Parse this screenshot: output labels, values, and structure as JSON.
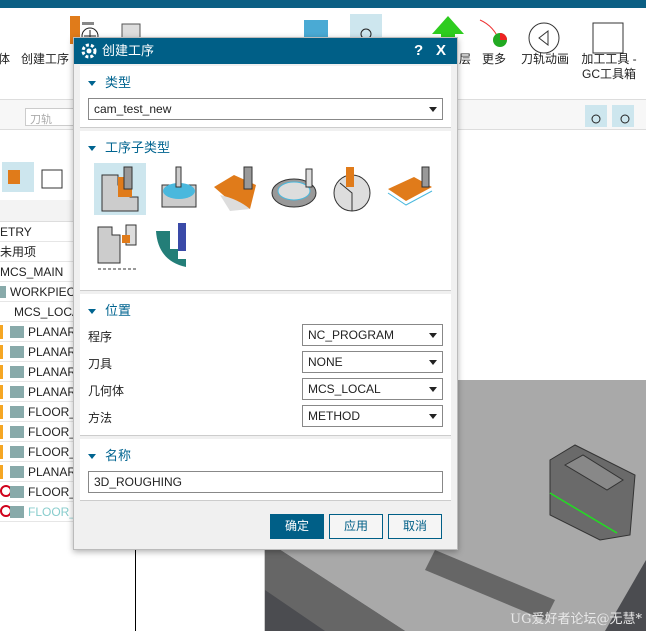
{
  "ribbon": {
    "items": [
      {
        "label": "体",
        "icon": "geometry-icon"
      },
      {
        "label": "创建工序",
        "icon": "create-operation-icon"
      },
      {
        "label": "层",
        "icon": "layer-icon"
      },
      {
        "label": "更多",
        "icon": "more-icon"
      },
      {
        "label": "刀轨动画",
        "icon": "toolpath-animation-icon"
      },
      {
        "label": "加工工具 -\nGC工具箱",
        "icon": "gc-toolbox-icon"
      }
    ],
    "filter_placeholder": "刀轨"
  },
  "navigator": {
    "rows": [
      {
        "label": "ETRY"
      },
      {
        "label": "未用项"
      },
      {
        "label": "MCS_MAIN"
      },
      {
        "label": "WORKPIECE"
      },
      {
        "label": "MCS_LOCAL"
      },
      {
        "label": "PLANAR",
        "status": "warning"
      },
      {
        "label": "PLANAR",
        "status": "warning"
      },
      {
        "label": "PLANAR",
        "status": "warning"
      },
      {
        "label": "PLANAR",
        "status": "warning"
      },
      {
        "label": "FLOOR_",
        "status": "warning"
      },
      {
        "label": "FLOOR_",
        "status": "warning"
      },
      {
        "label": "FLOOR_",
        "status": "warning"
      },
      {
        "label": "PLANAR",
        "status": "warning"
      },
      {
        "label": "FLOOR_",
        "status": "error"
      },
      {
        "label": "FLOOR_",
        "status": "error",
        "dimmed": true
      }
    ]
  },
  "dialog": {
    "title": "创建工序",
    "help": "?",
    "close": "X",
    "type_section": {
      "title": "类型",
      "value": "cam_test_new"
    },
    "subtype_section": {
      "title": "工序子类型",
      "subtypes": [
        "cavity-mill",
        "adaptive-milling",
        "zlevel-profile",
        "plunge-milling",
        "corner-rough",
        "rest-milling",
        "turning-rough",
        "zlevel-corner"
      ],
      "selected": 0
    },
    "location_section": {
      "title": "位置",
      "fields": [
        {
          "label": "程序",
          "value": "NC_PROGRAM"
        },
        {
          "label": "刀具",
          "value": "NONE"
        },
        {
          "label": "几何体",
          "value": "MCS_LOCAL"
        },
        {
          "label": "方法",
          "value": "METHOD"
        }
      ]
    },
    "name_section": {
      "title": "名称",
      "value": "3D_ROUGHING"
    },
    "buttons": {
      "ok": "确定",
      "apply": "应用",
      "cancel": "取消"
    }
  },
  "watermark": "UG爱好者论坛@无慧*",
  "colors": {
    "accent": "#005f87",
    "selected_tile": "#cde6ee",
    "edge_highlight": "#22dd22"
  }
}
